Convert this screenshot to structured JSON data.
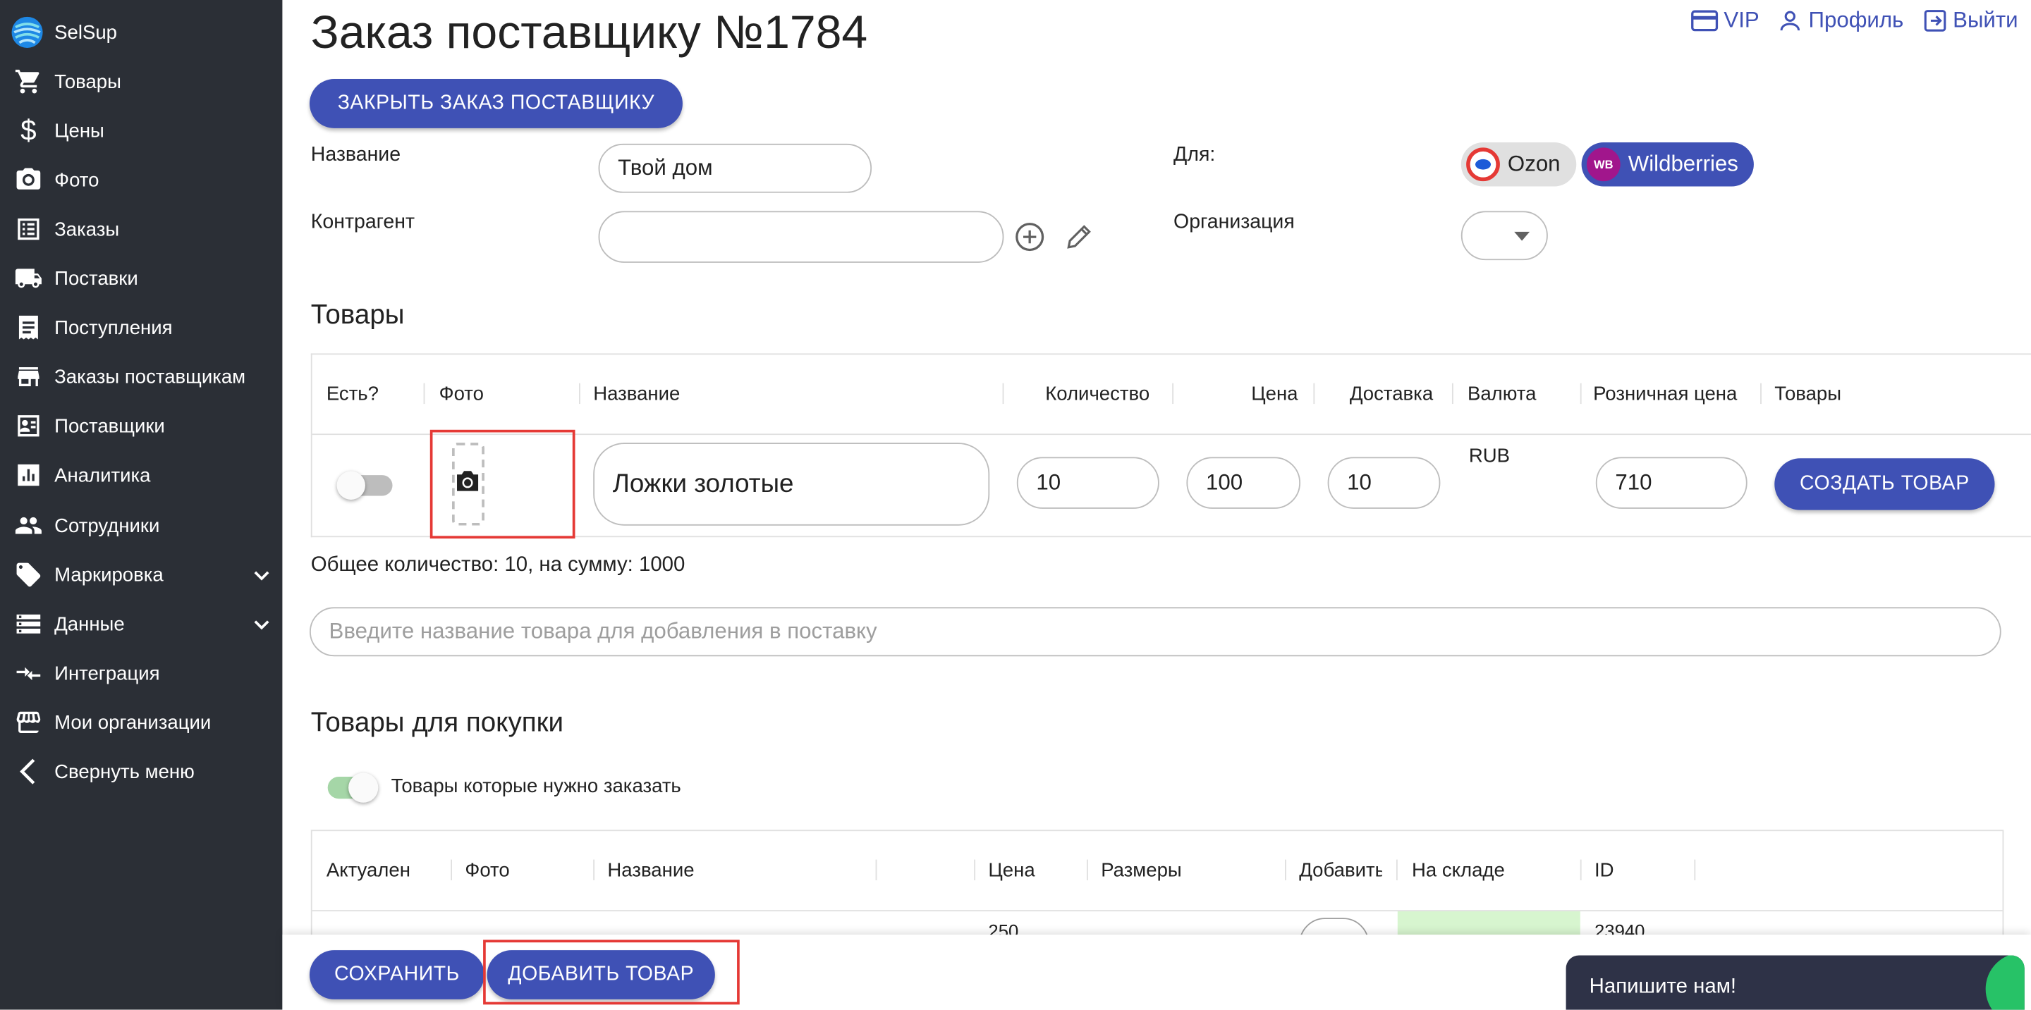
{
  "brand": {
    "name": "SelSup"
  },
  "sidebar": {
    "items": [
      {
        "label": "Товары",
        "icon": "cart-icon"
      },
      {
        "label": "Цены",
        "icon": "dollar-icon"
      },
      {
        "label": "Фото",
        "icon": "camera-icon"
      },
      {
        "label": "Заказы",
        "icon": "list-icon"
      },
      {
        "label": "Поставки",
        "icon": "truck-icon"
      },
      {
        "label": "Поступления",
        "icon": "receipt-icon"
      },
      {
        "label": "Заказы поставщикам",
        "icon": "store-icon"
      },
      {
        "label": "Поставщики",
        "icon": "contact-card-icon"
      },
      {
        "label": "Аналитика",
        "icon": "chart-icon"
      },
      {
        "label": "Сотрудники",
        "icon": "people-icon"
      },
      {
        "label": "Маркировка",
        "icon": "tag-icon",
        "expandable": true
      },
      {
        "label": "Данные",
        "icon": "storage-icon",
        "expandable": true
      },
      {
        "label": "Интеграция",
        "icon": "integration-icon"
      },
      {
        "label": "Мои организации",
        "icon": "storefront-icon"
      },
      {
        "label": "Свернуть меню",
        "icon": "chevron-left-icon"
      }
    ]
  },
  "header": {
    "title": "Заказ поставщику №1784",
    "links": {
      "vip": "VIP",
      "profile": "Профиль",
      "logout": "Выйти"
    }
  },
  "actions": {
    "close_order": "ЗАКРЫТЬ ЗАКАЗ ПОСТАВЩИКУ"
  },
  "form": {
    "name_label": "Название",
    "name_value": "Твой дом",
    "contractor_label": "Контрагент",
    "contractor_value": "",
    "for_label": "Для:",
    "marketplaces": [
      "Ozon",
      "Wildberries"
    ],
    "wb_badge": "WB",
    "org_label": "Организация",
    "org_value": ""
  },
  "goods": {
    "title": "Товары",
    "columns": [
      "Есть?",
      "Фото",
      "Название",
      "Количество",
      "Цена",
      "Доставка",
      "Валюта",
      "Розничная цена",
      "Товары"
    ],
    "rows": [
      {
        "in_stock": false,
        "name": "Ложки золотые",
        "quantity": "10",
        "price": "100",
        "delivery": "10",
        "currency": "RUB",
        "retail_price": "710",
        "action": "СОЗДАТЬ ТОВАР"
      }
    ],
    "total": "Общее количество: 10, на сумму: 1000",
    "add_placeholder": "Введите название товара для добавления в поставку"
  },
  "purchase": {
    "title": "Товары для покупки",
    "toggle_label": "Товары которые нужно заказать",
    "toggle_on": true,
    "columns": [
      "Актуален",
      "Фото",
      "Название",
      "Цена",
      "Размеры",
      "Добавить",
      "На складе",
      "ID"
    ],
    "rows": [
      {
        "price": "250",
        "id": "23940"
      }
    ]
  },
  "footer": {
    "save": "СОХРАНИТЬ",
    "add_product": "ДОБАВИТЬ ТОВАР",
    "chat": "Напишите нам!"
  },
  "colors": {
    "primary": "#3f51b5",
    "sidebar": "#2b2f36",
    "highlight": "#e53935",
    "stock_green": "#d7f5cf"
  }
}
